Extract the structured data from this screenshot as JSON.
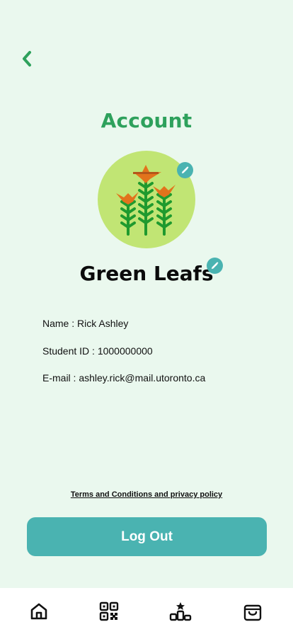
{
  "header": {
    "title": "Account"
  },
  "profile": {
    "name": "Green Leafs",
    "avatar_icon": "wheat-plants-icon"
  },
  "info": {
    "name": "Name : Rick Ashley",
    "student_id": "Student ID : 1000000000",
    "email": "E-mail : ashley.rick@mail.utoronto.ca"
  },
  "links": {
    "terms": "Terms and Conditions and privacy policy"
  },
  "actions": {
    "logout": "Log Out"
  },
  "bottom_nav": {
    "items": [
      {
        "icon": "home-icon"
      },
      {
        "icon": "qr-code-icon"
      },
      {
        "icon": "leaderboard-icon"
      },
      {
        "icon": "shopping-bag-icon"
      }
    ]
  },
  "colors": {
    "background": "#eaf8ee",
    "accent_green": "#2ea15c",
    "teal": "#4ab3b1",
    "avatar_bg": "#c1e574",
    "plant_green": "#1f9a2e",
    "leaf_orange": "#e2731c"
  }
}
